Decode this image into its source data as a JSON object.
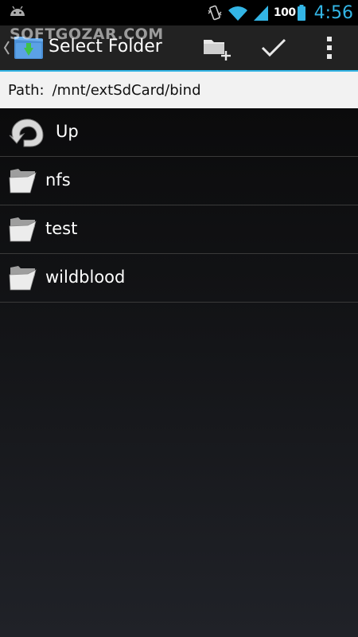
{
  "status_bar": {
    "battery_level": "100",
    "time": "4:56",
    "icons": [
      "android-icon",
      "vibrate-icon",
      "wifi-icon",
      "signal-icon",
      "battery-icon"
    ]
  },
  "action_bar": {
    "title": "Select Folder",
    "watermark": "SOFTGOZAR.COM",
    "actions": {
      "new_folder": "new-folder-icon",
      "confirm": "checkmark-icon",
      "overflow": "overflow-menu-icon"
    }
  },
  "path_bar": {
    "label": "Path:",
    "value": "/mnt/extSdCard/bind"
  },
  "items": [
    {
      "label": "Up",
      "icon": "up-arrow-icon"
    },
    {
      "label": "nfs",
      "icon": "folder-icon"
    },
    {
      "label": "test",
      "icon": "folder-icon"
    },
    {
      "label": "wildblood",
      "icon": "folder-icon"
    }
  ],
  "colors": {
    "accent": "#33b5e5",
    "action_bar_bg": "#222222",
    "path_bar_bg": "#f2f2f2"
  }
}
